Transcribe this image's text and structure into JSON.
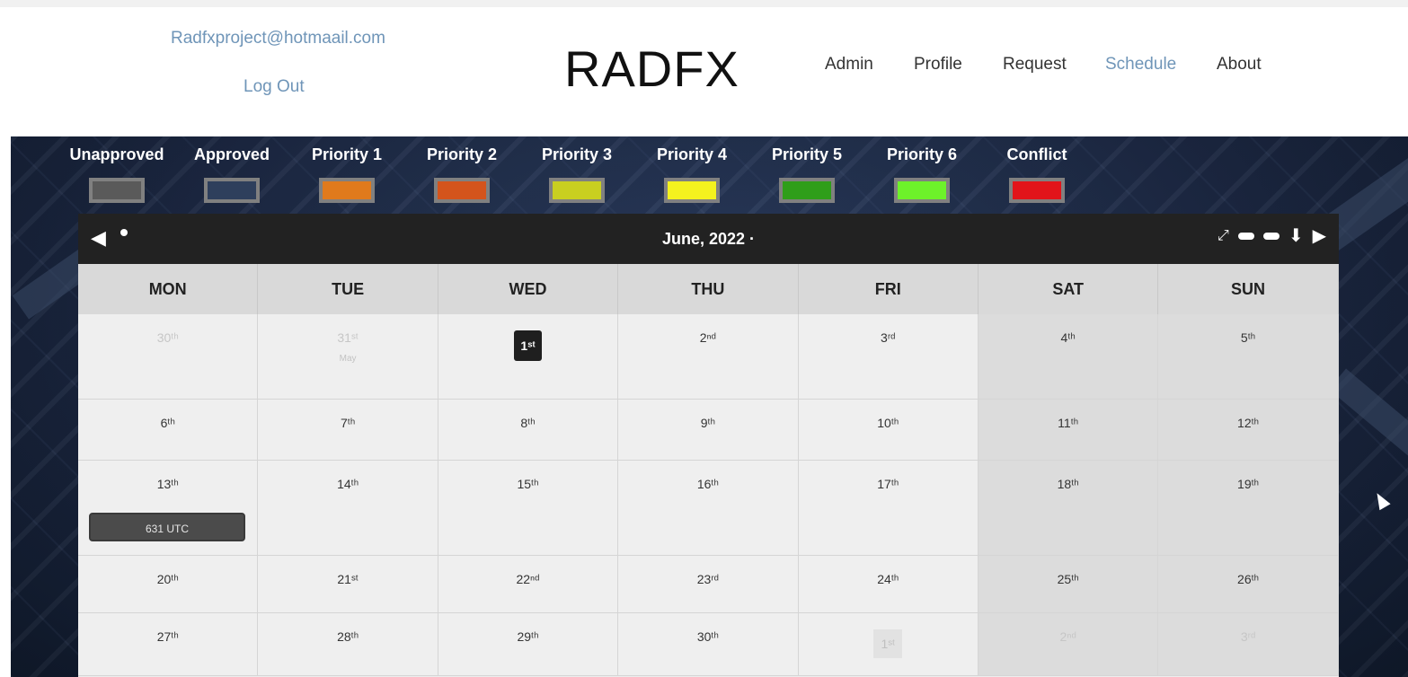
{
  "header": {
    "email": "Radfxproject@hotmaail.com",
    "logout": "Log Out",
    "brand": "RADFX",
    "nav": [
      "Admin",
      "Profile",
      "Request",
      "Schedule",
      "About"
    ],
    "active_nav": "Schedule"
  },
  "legend": [
    {
      "label": "Unapproved",
      "color": "#5a5a5a"
    },
    {
      "label": "Approved",
      "color": "#2e3f5c"
    },
    {
      "label": "Priority 1",
      "color": "#e07a1c"
    },
    {
      "label": "Priority 2",
      "color": "#d4541c"
    },
    {
      "label": "Priority 3",
      "color": "#c9cf20"
    },
    {
      "label": "Priority 4",
      "color": "#f4f21e"
    },
    {
      "label": "Priority 5",
      "color": "#2f9e1a"
    },
    {
      "label": "Priority 6",
      "color": "#6df22a"
    },
    {
      "label": "Conflict",
      "color": "#e2141a"
    }
  ],
  "calendar": {
    "title": "June, 2022 ·",
    "prev": "◀",
    "next": "▶",
    "weekdays": [
      "MON",
      "TUE",
      "WED",
      "THU",
      "FRI",
      "SAT",
      "SUN"
    ],
    "weeks": [
      [
        {
          "d": "30ᵗʰ",
          "other": true
        },
        {
          "d": "31ˢᵗ",
          "other": true,
          "sub": "May"
        },
        {
          "d": "1ˢᵗ",
          "today": true
        },
        {
          "d": "2ⁿᵈ"
        },
        {
          "d": "3ʳᵈ"
        },
        {
          "d": "4ᵗʰ"
        },
        {
          "d": "5ᵗʰ"
        }
      ],
      [
        {
          "d": "6ᵗʰ"
        },
        {
          "d": "7ᵗʰ"
        },
        {
          "d": "8ᵗʰ"
        },
        {
          "d": "9ᵗʰ"
        },
        {
          "d": "10ᵗʰ"
        },
        {
          "d": "11ᵗʰ"
        },
        {
          "d": "12ᵗʰ"
        }
      ],
      [
        {
          "d": "13ᵗʰ",
          "event": "631 UTC"
        },
        {
          "d": "14ᵗʰ"
        },
        {
          "d": "15ᵗʰ"
        },
        {
          "d": "16ᵗʰ"
        },
        {
          "d": "17ᵗʰ"
        },
        {
          "d": "18ᵗʰ"
        },
        {
          "d": "19ᵗʰ"
        }
      ],
      [
        {
          "d": "20ᵗʰ"
        },
        {
          "d": "21ˢᵗ"
        },
        {
          "d": "22ⁿᵈ"
        },
        {
          "d": "23ʳᵈ"
        },
        {
          "d": "24ᵗʰ"
        },
        {
          "d": "25ᵗʰ"
        },
        {
          "d": "26ᵗʰ"
        }
      ],
      [
        {
          "d": "27ᵗʰ"
        },
        {
          "d": "28ᵗʰ"
        },
        {
          "d": "29ᵗʰ"
        },
        {
          "d": "30ᵗʰ"
        },
        {
          "d": "1ˢᵗ",
          "other": true,
          "faded": true
        },
        {
          "d": "2ⁿᵈ",
          "other": true
        },
        {
          "d": "3ʳᵈ",
          "other": true
        }
      ]
    ]
  }
}
